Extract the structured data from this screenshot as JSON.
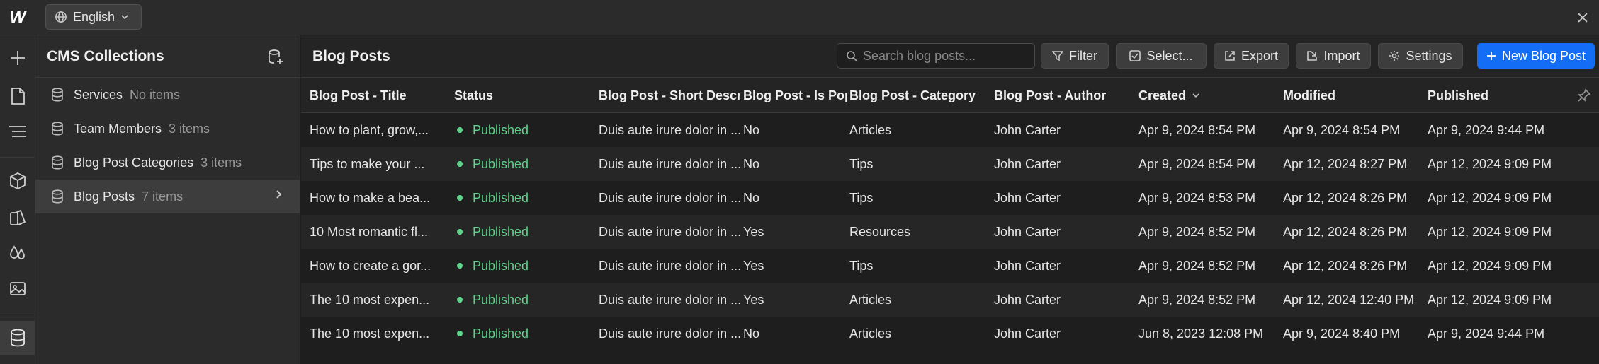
{
  "topbar": {
    "logo": "W",
    "language": "English"
  },
  "collections_panel": {
    "title": "CMS Collections",
    "items": [
      {
        "name": "Services",
        "count": "No items"
      },
      {
        "name": "Team Members",
        "count": "3 items"
      },
      {
        "name": "Blog Post Categories",
        "count": "3 items"
      },
      {
        "name": "Blog Posts",
        "count": "7 items"
      }
    ]
  },
  "main": {
    "title": "Blog Posts",
    "search_placeholder": "Search blog posts...",
    "buttons": {
      "filter": "Filter",
      "select": "Select...",
      "export": "Export",
      "import": "Import",
      "settings": "Settings",
      "new": "New Blog Post"
    }
  },
  "table": {
    "columns": [
      "Blog Post - Title",
      "Status",
      "Blog Post - Short Descri",
      "Blog Post - Is Popu",
      "Blog Post - Category",
      "Blog Post - Author",
      "Created",
      "Modified",
      "Published"
    ],
    "rows": [
      {
        "title": "How to plant, grow,...",
        "status": "Published",
        "desc": "Duis aute irure dolor in ...",
        "popular": "No",
        "category": "Articles",
        "author": "John Carter",
        "created": "Apr 9, 2024 8:54 PM",
        "modified": "Apr 9, 2024 8:54 PM",
        "published": "Apr 9, 2024 9:44 PM"
      },
      {
        "title": "Tips to make your ...",
        "status": "Published",
        "desc": "Duis aute irure dolor in ...",
        "popular": "No",
        "category": "Tips",
        "author": "John Carter",
        "created": "Apr 9, 2024 8:54 PM",
        "modified": "Apr 12, 2024 8:27 PM",
        "published": "Apr 12, 2024 9:09 PM"
      },
      {
        "title": "How to make a bea...",
        "status": "Published",
        "desc": "Duis aute irure dolor in ...",
        "popular": "No",
        "category": "Tips",
        "author": "John Carter",
        "created": "Apr 9, 2024 8:53 PM",
        "modified": "Apr 12, 2024 8:26 PM",
        "published": "Apr 12, 2024 9:09 PM"
      },
      {
        "title": "10 Most romantic fl...",
        "status": "Published",
        "desc": "Duis aute irure dolor in ...",
        "popular": "Yes",
        "category": "Resources",
        "author": "John Carter",
        "created": "Apr 9, 2024 8:52 PM",
        "modified": "Apr 12, 2024 8:26 PM",
        "published": "Apr 12, 2024 9:09 PM"
      },
      {
        "title": "How to create a gor...",
        "status": "Published",
        "desc": "Duis aute irure dolor in ...",
        "popular": "Yes",
        "category": "Tips",
        "author": "John Carter",
        "created": "Apr 9, 2024 8:52 PM",
        "modified": "Apr 12, 2024 8:26 PM",
        "published": "Apr 12, 2024 9:09 PM"
      },
      {
        "title": "The 10 most expen...",
        "status": "Published",
        "desc": "Duis aute irure dolor in ...",
        "popular": "Yes",
        "category": "Articles",
        "author": "John Carter",
        "created": "Apr 9, 2024 8:52 PM",
        "modified": "Apr 12, 2024 12:40 PM",
        "published": "Apr 12, 2024 9:09 PM"
      },
      {
        "title": "The 10 most expen...",
        "status": "Published",
        "desc": "Duis aute irure dolor in ...",
        "popular": "No",
        "category": "Articles",
        "author": "John Carter",
        "created": "Jun 8, 2023 12:08 PM",
        "modified": "Apr 9, 2024 8:40 PM",
        "published": "Apr 9, 2024 9:44 PM"
      }
    ]
  },
  "colors": {
    "accent": "#146ef5",
    "published": "#5ed38a"
  }
}
